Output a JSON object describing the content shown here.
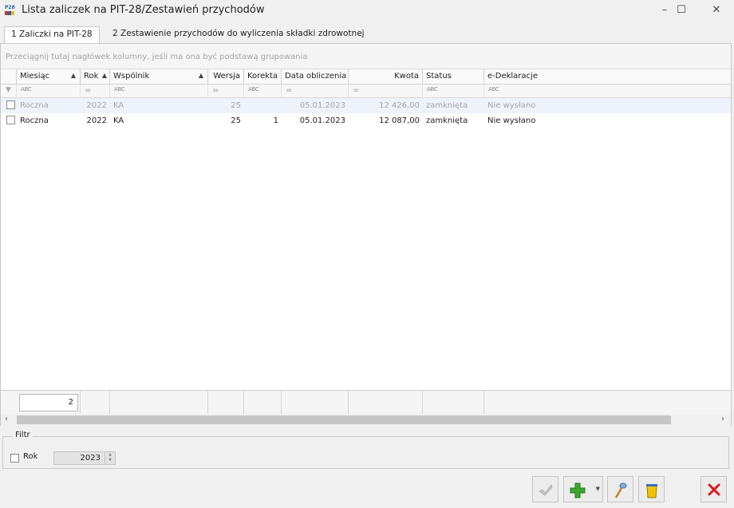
{
  "window": {
    "title": "Lista zaliczek na PIT-28/Zestawień przychodów",
    "icon_text_top": "P28"
  },
  "tabs": [
    {
      "label": "1 Zaliczki na PIT-28"
    },
    {
      "label": "2 Zestawienie przychodów do wyliczenia składki zdrowotnej"
    }
  ],
  "group_hint": "Przeciągnij tutaj nagłówek kolumny, jeśli ma ona być podstawą grupowania",
  "columns": {
    "miesiac": "Miesiąc",
    "rok": "Rok",
    "wspolnik": "Wspólnik",
    "wersja": "Wersja",
    "korekta": "Korekta",
    "data": "Data obliczenia",
    "kwota": "Kwota",
    "status": "Status",
    "edekl": "e-Deklaracje"
  },
  "filter_row": {
    "abc": "ABC",
    "eq": "="
  },
  "rows": [
    {
      "miesiac": "Roczna",
      "rok": "2022",
      "wspolnik": "KA",
      "wersja": "25",
      "korekta": "",
      "data": "05.01.2023",
      "kwota": "12 426,00",
      "status": "zamknięta",
      "edekl": "Nie wysłano"
    },
    {
      "miesiac": "Roczna",
      "rok": "2022",
      "wspolnik": "KA",
      "wersja": "25",
      "korekta": "1",
      "data": "05.01.2023",
      "kwota": "12 087,00",
      "status": "zamknięta",
      "edekl": "Nie wysłano"
    }
  ],
  "footer": {
    "count": "2"
  },
  "filtr": {
    "legend": "Filtr",
    "rok_label": "Rok",
    "rok_value": "2023"
  }
}
